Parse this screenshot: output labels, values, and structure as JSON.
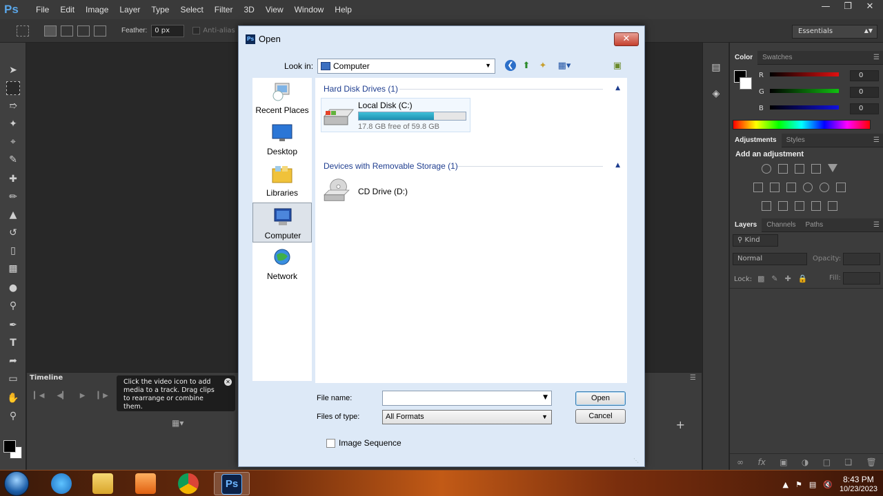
{
  "app": {
    "logo": "Ps",
    "menu": [
      "File",
      "Edit",
      "Image",
      "Layer",
      "Type",
      "Select",
      "Filter",
      "3D",
      "View",
      "Window",
      "Help"
    ],
    "window_controls": [
      "minimize-icon",
      "restore-icon",
      "close-icon"
    ]
  },
  "options_bar": {
    "feather_label": "Feather:",
    "feather_value": "0 px",
    "antialias_label": "Anti-alias",
    "workspace": "Essentials"
  },
  "timeline": {
    "title": "Timeline",
    "tooltip": "Click the video icon to add media to a track. Drag clips to rearrange or combine them."
  },
  "color_panel": {
    "tabs": [
      "Color",
      "Swatches"
    ],
    "channels": [
      {
        "label": "R",
        "value": "0",
        "color": "#e01010"
      },
      {
        "label": "G",
        "value": "0",
        "color": "#10c010"
      },
      {
        "label": "B",
        "value": "0",
        "color": "#1010e0"
      }
    ]
  },
  "adjustments_panel": {
    "tabs": [
      "Adjustments",
      "Styles"
    ],
    "heading": "Add an adjustment"
  },
  "layers_panel": {
    "tabs": [
      "Layers",
      "Channels",
      "Paths"
    ],
    "kind_filter": "Kind",
    "blend_mode": "Normal",
    "opacity_label": "Opacity:",
    "lock_label": "Lock:",
    "fill_label": "Fill:"
  },
  "dialog": {
    "title": "Open",
    "look_in_label": "Look in:",
    "look_in_value": "Computer",
    "places": [
      {
        "label": "Recent Places",
        "icon": "recent-places-icon"
      },
      {
        "label": "Desktop",
        "icon": "desktop-icon"
      },
      {
        "label": "Libraries",
        "icon": "libraries-icon"
      },
      {
        "label": "Computer",
        "icon": "computer-icon"
      },
      {
        "label": "Network",
        "icon": "network-icon"
      }
    ],
    "groups": [
      {
        "header": "Hard Disk Drives (1)"
      },
      {
        "header": "Devices with Removable Storage (1)"
      }
    ],
    "drive_c": {
      "name": "Local Disk (C:)",
      "free_text": "17.8 GB free of 59.8 GB",
      "used_fraction": 0.7
    },
    "drive_d": {
      "name": "CD Drive (D:)"
    },
    "file_name_label": "File name:",
    "file_name_value": "",
    "file_type_label": "Files of type:",
    "file_type_value": "All Formats",
    "open_button": "Open",
    "cancel_button": "Cancel",
    "image_sequence_label": "Image Sequence"
  },
  "taskbar": {
    "apps": [
      "internet-explorer-icon",
      "file-explorer-icon",
      "media-player-icon",
      "chrome-icon",
      "photoshop-icon"
    ],
    "photoshop_label": "Ps",
    "time": "8:43 PM",
    "date": "10/23/2023"
  }
}
